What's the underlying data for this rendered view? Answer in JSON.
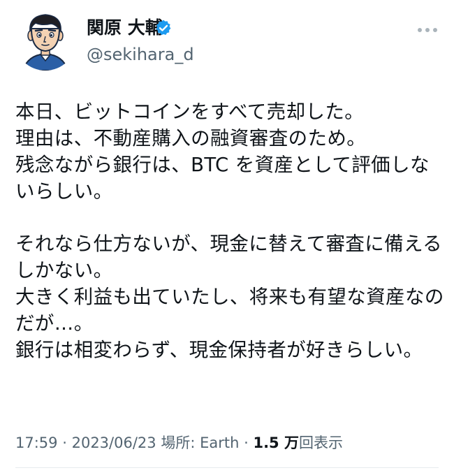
{
  "author": {
    "display_name": "関原 大輔",
    "handle": "@sekihara_d",
    "verified_icon": "verified-badge-icon",
    "verified_color": "#1d9bf0"
  },
  "menu_icon": "more-horizontal-icon",
  "tweet": {
    "lines": [
      "本日、ビットコインをすべて売却した。",
      "理由は、不動産購入の融資審査のため。",
      "残念ながら銀行は、BTC を資産として評価しな",
      "いらしい。",
      "",
      "それなら仕方ないが、現金に替えて審査に備える",
      "しかない。",
      "大きく利益も出ていたし、将来も有望な資産なの",
      "だが…。",
      "銀行は相変わらず、現金保持者が好きらしい。"
    ]
  },
  "meta": {
    "time": "17:59",
    "separator": "·",
    "date": "2023/06/23",
    "location": "場所: Earth",
    "views_count": "1.5 万",
    "views_label": "回表示"
  }
}
